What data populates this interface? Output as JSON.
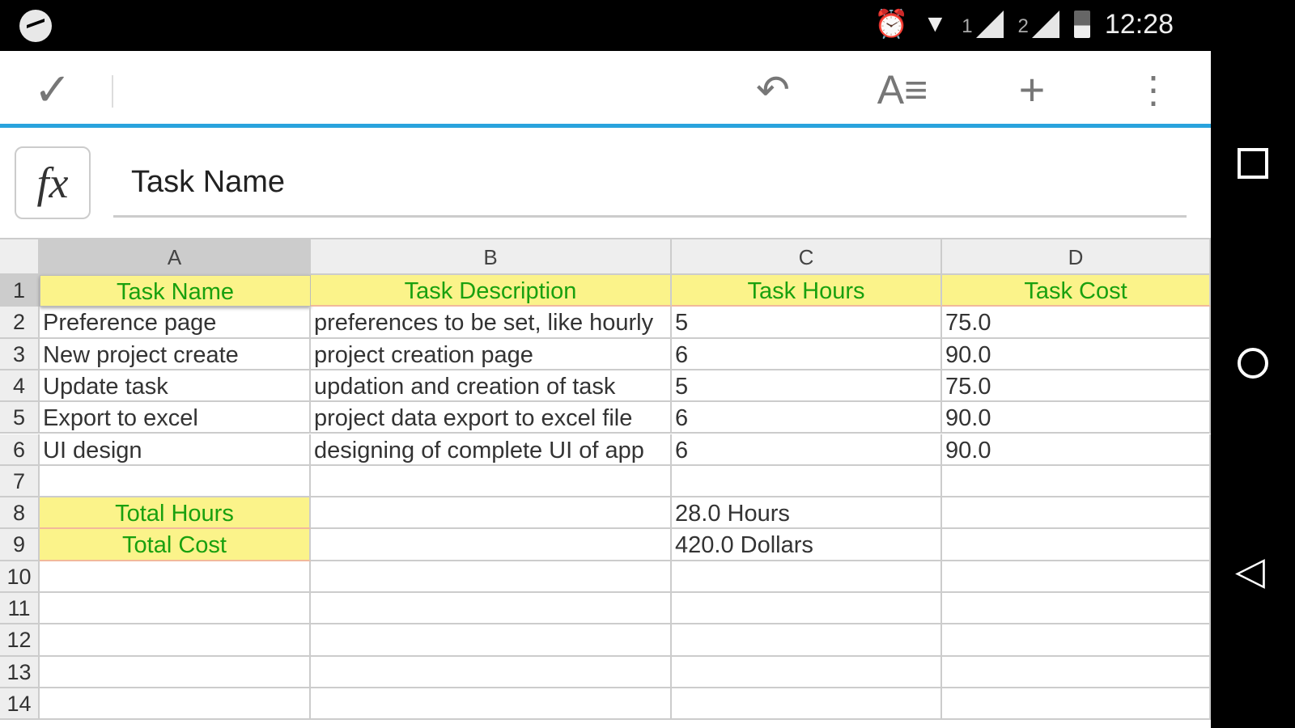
{
  "status_bar": {
    "time": "12:28",
    "sim1": "1",
    "sim2": "2",
    "icons": [
      "messenger-icon",
      "alarm-icon",
      "wifi-icon",
      "signal-icon",
      "battery-icon"
    ]
  },
  "toolbar": {
    "icons": [
      "check-icon",
      "undo-icon",
      "text-format-icon",
      "add-icon",
      "more-icon"
    ]
  },
  "formula_bar": {
    "fx_label": "fx",
    "value": "Task Name"
  },
  "columns": [
    "A",
    "B",
    "C",
    "D"
  ],
  "row_numbers": [
    "1",
    "2",
    "3",
    "4",
    "5",
    "6",
    "7",
    "8",
    "9",
    "10",
    "11",
    "12",
    "13",
    "14"
  ],
  "rows": [
    [
      "Task Name",
      "Task Description",
      "Task Hours",
      "Task Cost"
    ],
    [
      "Preference page",
      "preferences to be set, like hourly",
      "5",
      "75.0"
    ],
    [
      "New project create",
      "project creation page",
      "6",
      "90.0"
    ],
    [
      "Update task",
      "updation and creation of task",
      "5",
      "75.0"
    ],
    [
      "Export to excel",
      "project data export to excel file",
      "6",
      "90.0"
    ],
    [
      "UI design",
      "designing of complete UI of app",
      "6",
      "90.0"
    ],
    [
      "",
      "",
      "",
      ""
    ],
    [
      "Total Hours",
      "",
      "28.0 Hours",
      ""
    ],
    [
      "Total Cost",
      "",
      "420.0 Dollars",
      ""
    ],
    [
      "",
      "",
      "",
      ""
    ],
    [
      "",
      "",
      "",
      ""
    ],
    [
      "",
      "",
      "",
      ""
    ],
    [
      "",
      "",
      "",
      ""
    ],
    [
      "",
      "",
      "",
      ""
    ]
  ],
  "colors": {
    "accent": "#29a3dd",
    "highlight_fill": "#fbf38a",
    "highlight_text": "#19a00f"
  }
}
